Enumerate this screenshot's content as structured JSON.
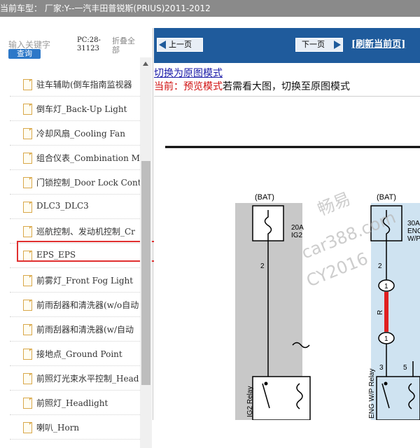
{
  "window": {
    "title": "当前车型：  厂家:Y--一汽丰田普锐斯(PRIUS)2011-2012"
  },
  "sidebar": {
    "search_label": "输入关键字",
    "search_button": "查询",
    "pc_code": "PC:28-31123",
    "collapse_label": "折叠全部",
    "items": [
      {
        "label": "驻车辅助(倒车指南监视器"
      },
      {
        "label": "倒车灯_Back-Up Light"
      },
      {
        "label": "冷却风扇_Cooling Fan"
      },
      {
        "label": "组合仪表_Combination Me"
      },
      {
        "label": "门锁控制_Door Lock Cont"
      },
      {
        "label": "DLC3_DLC3"
      },
      {
        "label": "巡航控制、发动机控制_Cr"
      },
      {
        "label": "EPS_EPS"
      },
      {
        "label": "前雾灯_Front Fog Light"
      },
      {
        "label": "前雨刮器和清洗器(w/o自动"
      },
      {
        "label": "前雨刮器和清洗器(w/自动"
      },
      {
        "label": "接地点_Ground Point"
      },
      {
        "label": "前照灯光束水平控制_Head"
      },
      {
        "label": "前照灯_Headlight"
      },
      {
        "label": "喇叭_Horn"
      }
    ]
  },
  "toolbar": {
    "prev_label": "上一页",
    "next_label": "下一页",
    "refresh_label": "[刷新当前页]"
  },
  "main": {
    "switch_link": "切换为原图模式",
    "mode_current": "当前：预览模式",
    "mode_hint": "若需看大图，切换至原图模式"
  },
  "diagram": {
    "bat_left": "(BAT)",
    "bat_right": "(BAT)",
    "fuse_left_line1": "20A",
    "fuse_left_line2": "IG2",
    "fuse_right_line1": "30A",
    "fuse_right_line2": "ENG",
    "fuse_right_line3": "W/P",
    "pin_left": "2",
    "pin_right_top": "2",
    "connector_top": "1",
    "connector_bottom": "1",
    "wire_color": "R",
    "pin_right_bottom": "3",
    "pin_right_bottom2": "5",
    "relay_left": "IG2 Relay",
    "relay_right": "ENG W/P Relay",
    "watermark_line1": "畅易",
    "watermark_line2": "car388.com",
    "watermark_line3": "CY2016"
  }
}
